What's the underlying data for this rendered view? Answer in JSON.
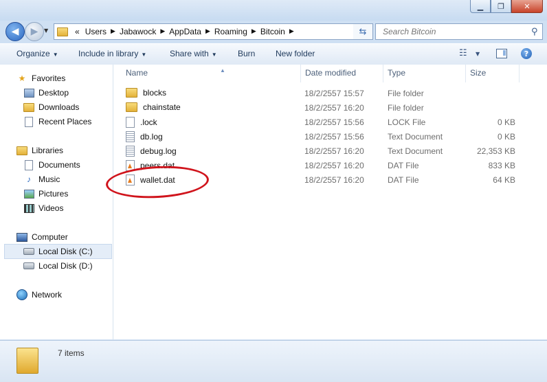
{
  "window": {
    "controls": {
      "minimize": "▁",
      "maximize": "❐",
      "close": "✕"
    }
  },
  "address_bar": {
    "overflow": "«",
    "crumbs": [
      "Users",
      "Jabawock",
      "AppData",
      "Roaming",
      "Bitcoin"
    ]
  },
  "search": {
    "placeholder": "Search Bitcoin"
  },
  "toolbar": {
    "organize": "Organize",
    "include_in_library": "Include in library",
    "share_with": "Share with",
    "burn": "Burn",
    "new_folder": "New folder"
  },
  "nav_pane": {
    "favorites": {
      "label": "Favorites",
      "items": [
        "Desktop",
        "Downloads",
        "Recent Places"
      ]
    },
    "libraries": {
      "label": "Libraries",
      "items": [
        "Documents",
        "Music",
        "Pictures",
        "Videos"
      ]
    },
    "computer": {
      "label": "Computer",
      "items": [
        "Local Disk (C:)",
        "Local Disk (D:)"
      ]
    },
    "network": {
      "label": "Network"
    }
  },
  "columns": {
    "name": "Name",
    "date": "Date modified",
    "type": "Type",
    "size": "Size"
  },
  "files": [
    {
      "name": "blocks",
      "date": "18/2/2557 15:57",
      "type": "File folder",
      "size": "",
      "icon": "folder"
    },
    {
      "name": "chainstate",
      "date": "18/2/2557 16:20",
      "type": "File folder",
      "size": "",
      "icon": "folder"
    },
    {
      "name": ".lock",
      "date": "18/2/2557 15:56",
      "type": "LOCK File",
      "size": "0 KB",
      "icon": "blank"
    },
    {
      "name": "db.log",
      "date": "18/2/2557 15:56",
      "type": "Text Document",
      "size": "0 KB",
      "icon": "text"
    },
    {
      "name": "debug.log",
      "date": "18/2/2557 16:20",
      "type": "Text Document",
      "size": "22,353 KB",
      "icon": "text"
    },
    {
      "name": "peers.dat",
      "date": "18/2/2557 16:20",
      "type": "DAT File",
      "size": "833 KB",
      "icon": "dat"
    },
    {
      "name": "wallet.dat",
      "date": "18/2/2557 16:20",
      "type": "DAT File",
      "size": "64 KB",
      "icon": "dat"
    }
  ],
  "status": {
    "item_count": "7 items"
  },
  "annotation": {
    "highlight_color": "#d0141c",
    "highlighted_file": "wallet.dat"
  }
}
